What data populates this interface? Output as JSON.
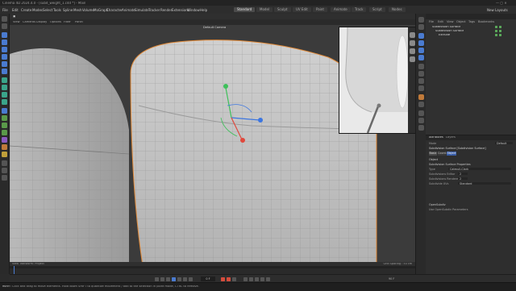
{
  "window": {
    "title": "Cinema 4D 2024.4.0 - [subd_weight_1.c4d *] - Main"
  },
  "menu": {
    "items": [
      "File",
      "Edit",
      "Create",
      "Modes",
      "Select",
      "Tools",
      "Spline",
      "Mesh",
      "Volume",
      "MoGraph",
      "Character",
      "Animate",
      "Simulate",
      "Tracker",
      "Render",
      "Extensions",
      "Window",
      "Help"
    ],
    "layouts": [
      "Standard",
      "Model",
      "Sculpt",
      "UV Edit",
      "Paint",
      "Animate",
      "Track",
      "Script",
      "Nodes"
    ],
    "active_layout": "Standard",
    "new_layouts": "New Layouts"
  },
  "viewport": {
    "menus": [
      "View",
      "Cameras",
      "Display",
      "Options",
      "Filter",
      "Panel"
    ],
    "camera_label": "Default Camera",
    "status_left": "View Transform: Project",
    "status_right": "Grid Spacing : 50 cm"
  },
  "object_manager": {
    "menus": [
      "File",
      "Edit",
      "View",
      "Object",
      "Tags",
      "Bookmarks"
    ],
    "objects": [
      {
        "name": "Subdivision Surface",
        "indent": 0,
        "color": "#e0c050"
      },
      {
        "name": "Subdivision Surface",
        "indent": 1,
        "color": "#e0c050"
      },
      {
        "name": "Extrude",
        "indent": 2,
        "color": "#e0c050"
      }
    ]
  },
  "attribute_manager": {
    "title": "Attributes",
    "tab": "Layers",
    "mode_label": "Mode",
    "mode_value": "Default",
    "object_label": "Subdivision Surface [Subdivision Surface]",
    "tabs": [
      "Basic",
      "Coord.",
      "Object"
    ],
    "section_object": "Object",
    "section_properties": "Subdivision Surface Properties",
    "fields": [
      {
        "label": "Type",
        "value": "Catmull-Clark"
      },
      {
        "label": "Subdivisions Editor",
        "value": "2"
      },
      {
        "label": "Subdivisions Renderer",
        "value": "2"
      },
      {
        "label": "Subdivide UVs",
        "value": "Standard"
      }
    ],
    "section_opensubdiv": "OpenSubdiv",
    "opensubdiv_line": "Use OpenSubdiv Parameters"
  },
  "timeline": {
    "frame": "0 F",
    "end_frame": "90 F"
  },
  "statusbar": {
    "text": "Move: Click and drag to move elements. Hold down SHIFT to quantize movement / add to the selection in point mode, CTRL to remove.",
    "frame": "90 F"
  },
  "colors": {
    "accent_blue": "#4a7bd0",
    "record_red": "#d54c3c",
    "selection_orange": "#e08a3a",
    "axis_x": "#e0483c",
    "axis_y": "#3ec05a",
    "axis_z": "#3c76e0"
  },
  "icons": {
    "left_toolbar": [
      "undo-icon",
      "redo-icon",
      "select-icon",
      "live-selection-icon",
      "move-icon",
      "scale-icon",
      "rotate-icon",
      "recent-icon",
      "polygon-pen-icon",
      "knife-icon",
      "extrude-icon",
      "bevel-icon",
      "cube-icon",
      "spline-icon",
      "nurbs-icon",
      "array-icon",
      "deformer-icon",
      "camera-icon",
      "light-icon",
      "render-icon",
      "paint-icon",
      "magnet-icon",
      "axis-icon",
      "snap-icon",
      "workplane-icon",
      "grid-icon",
      "isoparm-icon",
      "polygon-icon",
      "point-icon",
      "edge-icon"
    ],
    "right_toolbar": [
      "model-mode-icon",
      "texture-mode-icon",
      "axis-mode-icon",
      "points-mode-icon",
      "edges-mode-icon",
      "polygons-mode-icon",
      "uv-mode-icon",
      "enable-axis-icon",
      "snapping-icon",
      "locked-workplane-icon",
      "planar-workplane-icon",
      "solo-icon",
      "viewport-solo-icon",
      "render-view-icon",
      "render-settings-icon",
      "picture-viewer-icon",
      "coordinate-icon",
      "material-icon",
      "xpresso-icon",
      "python-icon",
      "asset-browser-icon",
      "layers-icon",
      "take-icon",
      "timeline-icon",
      "script-icon"
    ]
  }
}
